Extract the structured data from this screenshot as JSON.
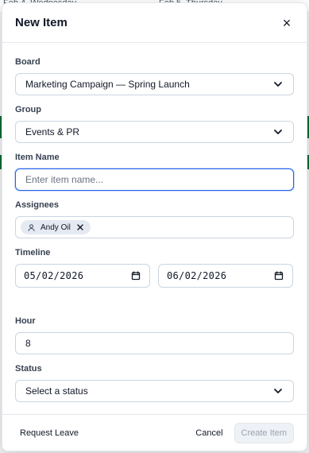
{
  "background": {
    "date_left": "Feb 4, Wednesday",
    "date_right": "Feb 5, Thursday"
  },
  "modal": {
    "title": "New Item",
    "close_icon": "close-icon",
    "fields": {
      "board": {
        "label": "Board",
        "value": "Marketing Campaign — Spring Launch"
      },
      "group": {
        "label": "Group",
        "value": "Events & PR"
      },
      "item_name": {
        "label": "Item Name",
        "placeholder": "Enter item name...",
        "value": ""
      },
      "assignees": {
        "label": "Assignees",
        "chips": [
          {
            "name": "Andy Oil",
            "icon": "user-icon"
          }
        ]
      },
      "timeline": {
        "label": "Timeline",
        "start": "05/02/2026",
        "end": "06/02/2026"
      },
      "hour": {
        "label": "Hour",
        "value": "8"
      },
      "status": {
        "label": "Status",
        "value": "Select a status"
      }
    },
    "footer": {
      "request_leave": "Request Leave",
      "cancel": "Cancel",
      "create": "Create Item"
    }
  },
  "colors": {
    "accent": "#2563eb",
    "border": "#cbd5e1",
    "background_green": "#0b6b38",
    "disabled_text": "#9ca3af",
    "disabled_bg": "#eef1f5"
  }
}
